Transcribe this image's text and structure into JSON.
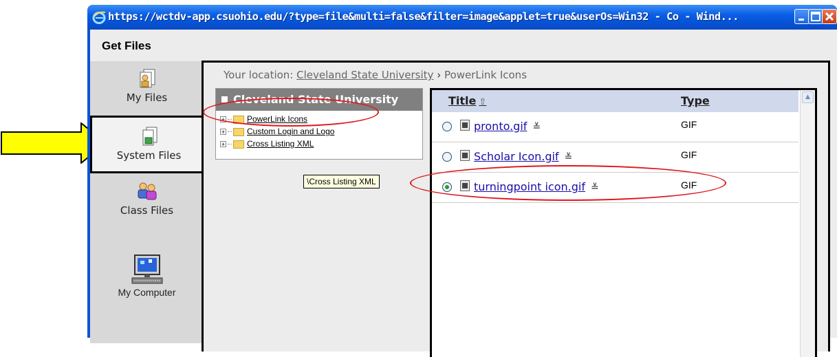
{
  "window": {
    "title": "https://wctdv-app.csuohio.edu/?type=file&multi=false&filter=image&applet=true&userOs=Win32 - Co - Wind..."
  },
  "dialog": {
    "title": "Get Files"
  },
  "sidebar": {
    "items": [
      {
        "label": "My Files",
        "icon": "my-files-icon"
      },
      {
        "label": "System Files",
        "icon": "system-files-icon",
        "active": true
      },
      {
        "label": "Class Files",
        "icon": "class-files-icon"
      },
      {
        "label": "My Computer",
        "icon": "my-computer-icon"
      }
    ]
  },
  "location": {
    "prefix": "Your location:",
    "link": "Cleveland State University",
    "separator": "›",
    "current": "PowerLink Icons"
  },
  "tree": {
    "header": "Cleveland State University",
    "items": [
      {
        "label": "PowerLink Icons"
      },
      {
        "label": "Custom Login and Logo"
      },
      {
        "label": "Cross Listing XML"
      }
    ],
    "tooltip": "\\Cross Listing XML"
  },
  "files": {
    "columns": {
      "title": "Title",
      "type": "Type"
    },
    "rows": [
      {
        "name": "pronto.gif",
        "type": "GIF",
        "selected": false
      },
      {
        "name": "Scholar Icon.gif",
        "type": "GIF",
        "selected": false
      },
      {
        "name": "turningpoint icon.gif",
        "type": "GIF",
        "selected": true
      }
    ]
  },
  "colors": {
    "titlebar": "#0a5ee6",
    "highlight_ellipse": "#e0161c",
    "arrow_fill": "#ffff00",
    "tree_header": "#808080",
    "file_header": "#d0d8ec"
  }
}
